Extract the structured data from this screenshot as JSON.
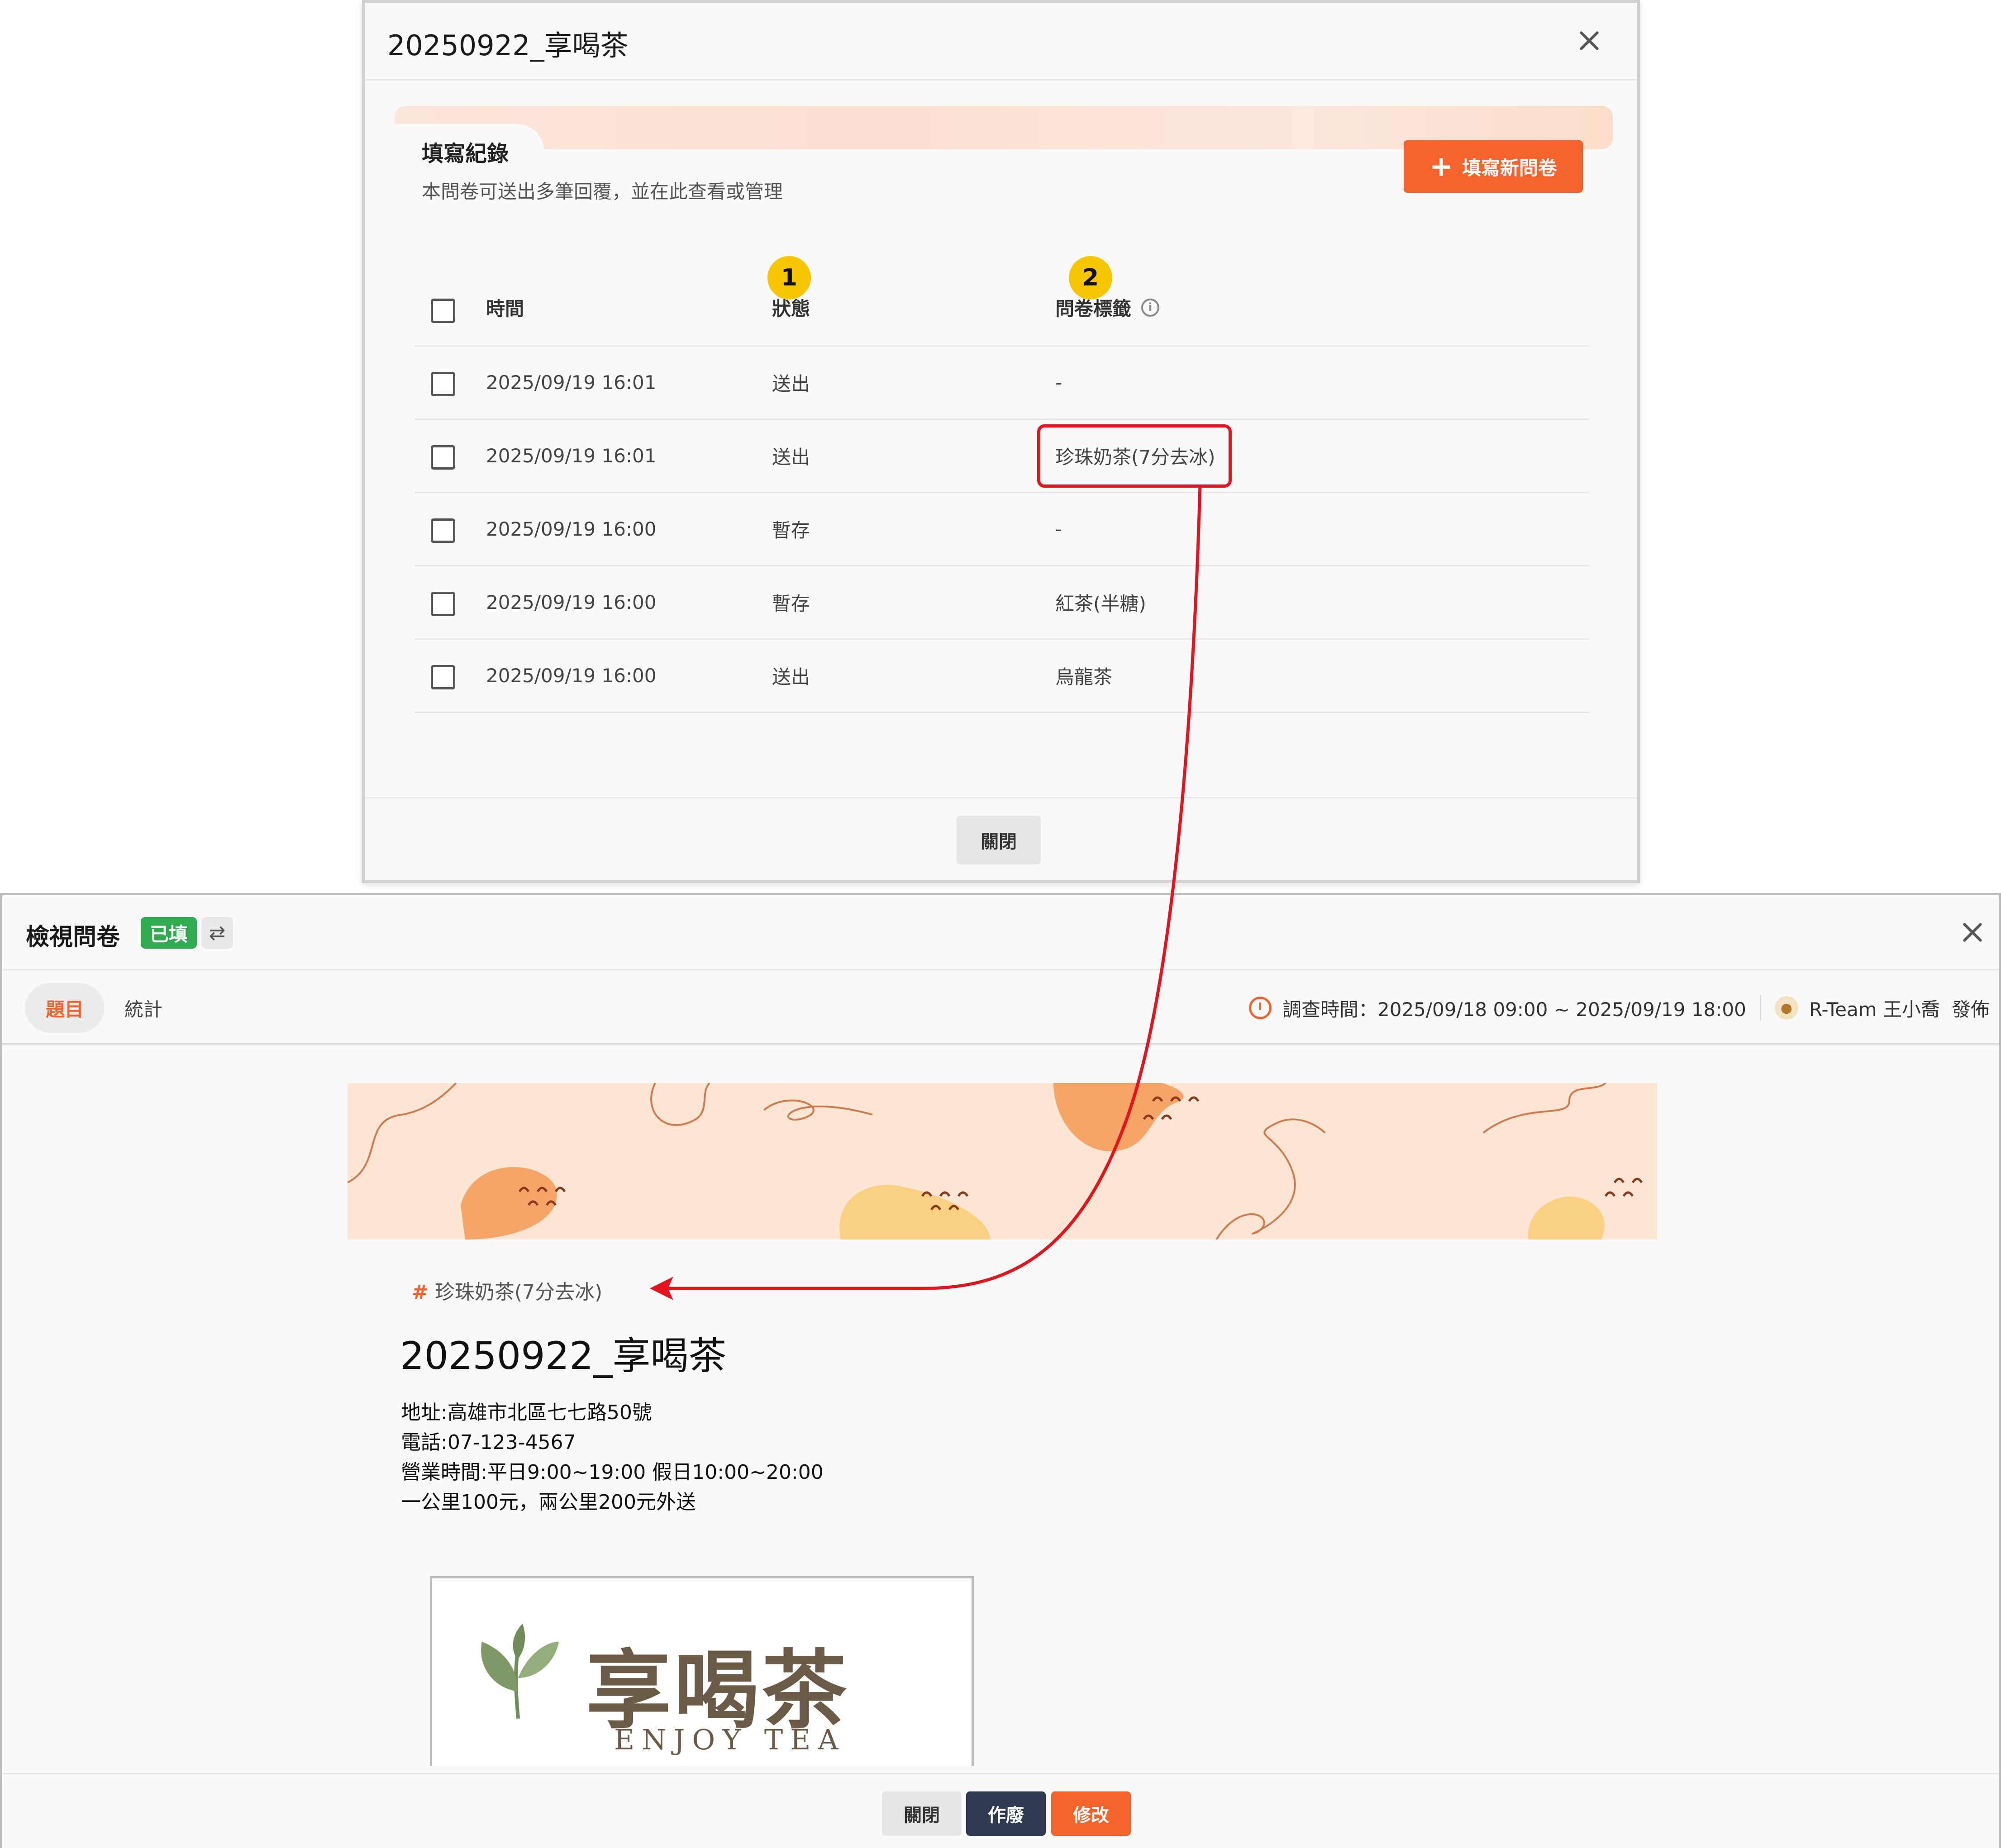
{
  "top_dialog": {
    "title": "20250922_享喝茶",
    "section_title": "填寫紀錄",
    "section_desc": "本問卷可送出多筆回覆，並在此查看或管理",
    "new_button_plus": "+",
    "new_button_label": "填寫新問卷",
    "badges": [
      "1",
      "2"
    ],
    "columns": {
      "time": "時間",
      "status": "狀態",
      "tag": "問卷標籤",
      "info_icon": "i"
    },
    "rows": [
      {
        "time": "2025/09/19 16:01",
        "status": "送出",
        "tag": "-"
      },
      {
        "time": "2025/09/19 16:01",
        "status": "送出",
        "tag": "珍珠奶茶(7分去冰)"
      },
      {
        "time": "2025/09/19 16:00",
        "status": "暫存",
        "tag": "-"
      },
      {
        "time": "2025/09/19 16:00",
        "status": "暫存",
        "tag": "紅茶(半糖)"
      },
      {
        "time": "2025/09/19 16:00",
        "status": "送出",
        "tag": "烏龍茶"
      }
    ],
    "close_label": "關閉"
  },
  "bottom_dialog": {
    "title": "檢視問卷",
    "filled_badge": "已填",
    "swap_icon": "⇄",
    "tabs": {
      "questions": "題目",
      "stats": "統計"
    },
    "survey_time": "調查時間：2025/09/18 09:00 ~ 2025/09/19 18:00",
    "publisher": "R-Team 王小喬",
    "publish_label": "發佈",
    "tag_hash": "#",
    "tag": "珍珠奶茶(7分去冰)",
    "survey_title": "20250922_享喝茶",
    "desc_lines": [
      "地址:高雄市北區七七路50號",
      "電話:07-123-4567",
      "營業時間:平日9:00~19:00 假日10:00~20:00",
      "一公里100元，兩公里200元外送"
    ],
    "logo_zh": "享喝茶",
    "logo_en": "ENJOY TEA",
    "buttons": {
      "close": "關閉",
      "void": "作廢",
      "edit": "修改"
    }
  },
  "colors": {
    "accent": "#f4632c",
    "filled_green": "#2eaa4f",
    "void_navy": "#2f3a52",
    "highlight_red": "#e3141e",
    "badge_yellow": "#f7c600",
    "logo_brown": "#6b5a45"
  },
  "icons": {
    "close": "close-icon",
    "info": "info-icon",
    "timer": "timer-icon",
    "avatar": "avatar",
    "swap": "swap-icon",
    "leaf": "tea-leaf-icon"
  }
}
